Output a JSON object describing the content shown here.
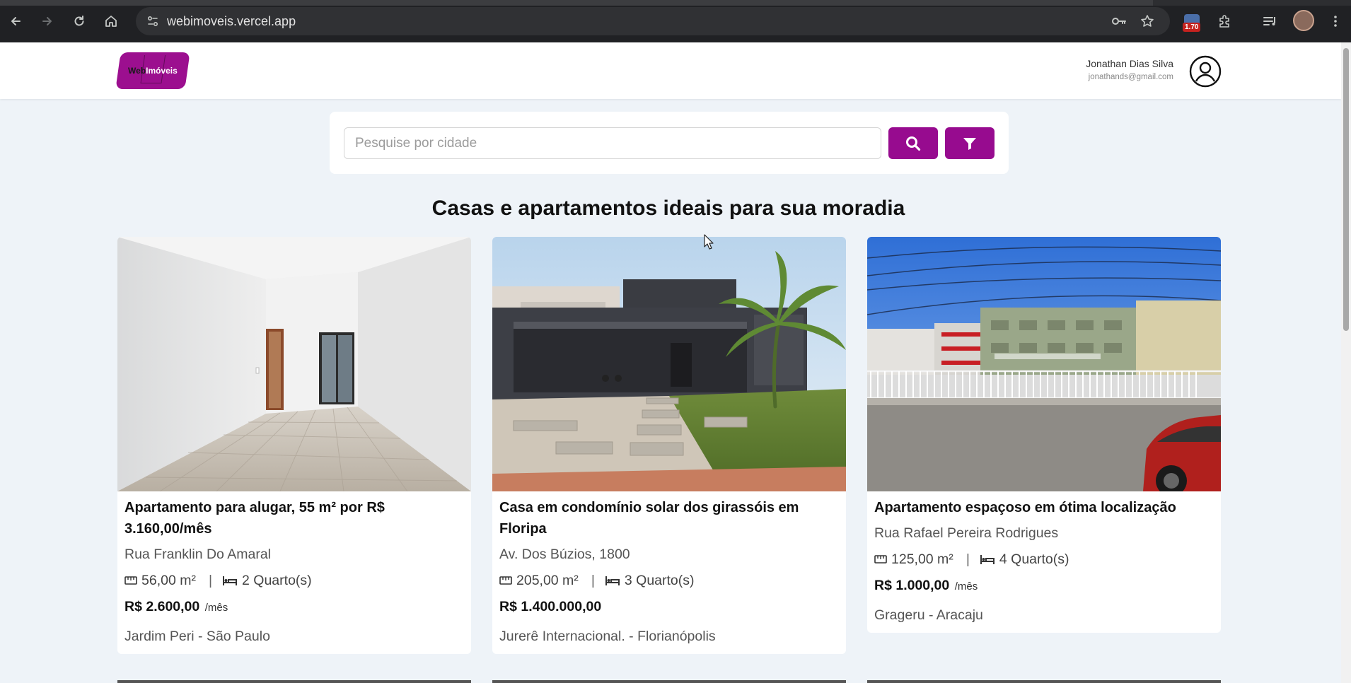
{
  "browser": {
    "url": "webimoveis.vercel.app",
    "extension_badge": "1.70"
  },
  "header": {
    "logo": {
      "part1": "Web",
      "part2": "Imóveis"
    },
    "user": {
      "name": "Jonathan Dias Silva",
      "email": "jonathands@gmail.com"
    }
  },
  "search": {
    "placeholder": "Pesquise por cidade",
    "value": ""
  },
  "main": {
    "heading": "Casas e apartamentos ideais para sua moradia"
  },
  "listings": [
    {
      "title": "Apartamento para alugar, 55 m² por R$ 3.160,00/mês",
      "address": "Rua Franklin Do Amaral",
      "area": "56,00 m²",
      "bedrooms": "2 Quarto(s)",
      "price": "R$ 2.600,00",
      "price_suffix": "/mês",
      "location": "Jardim Peri - São Paulo"
    },
    {
      "title": "Casa em condomínio solar dos girassóis em Floripa",
      "address": "Av. Dos Búzios, 1800",
      "area": "205,00 m²",
      "bedrooms": "3 Quarto(s)",
      "price": "R$ 1.400.000,00",
      "price_suffix": "",
      "location": "Jurerê Internacional. - Florianópolis"
    },
    {
      "title": "Apartamento espaçoso em ótima localização",
      "address": "Rua Rafael Pereira Rodrigues",
      "area": "125,00 m²",
      "bedrooms": "4 Quarto(s)",
      "price": "R$ 1.000,00",
      "price_suffix": "/mês",
      "location": "Grageru - Aracaju"
    }
  ],
  "colors": {
    "brand": "#970b8f",
    "background": "#eef3f8"
  }
}
